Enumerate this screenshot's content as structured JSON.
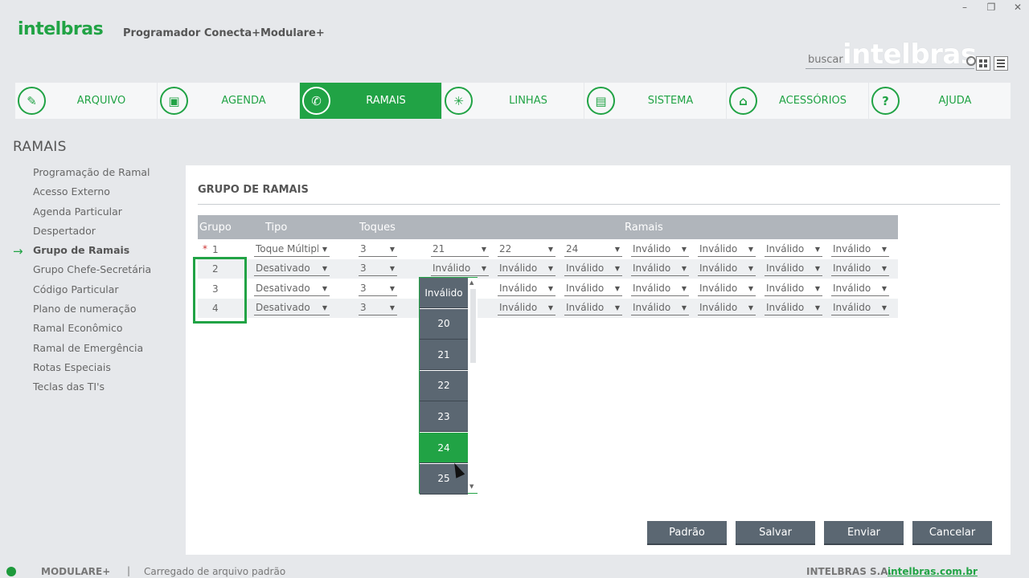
{
  "app": {
    "brand": "intelbras",
    "title": "Programador Conecta+Modulare+",
    "window_controls": [
      "–",
      "❐",
      "✕"
    ]
  },
  "search": {
    "label": "buscar",
    "brand": "intelbras"
  },
  "nav": {
    "tabs": [
      {
        "label": "ARQUIVO",
        "icon": "paperclip-icon",
        "glyph": "✎",
        "active": false
      },
      {
        "label": "AGENDA",
        "icon": "contacts-icon",
        "glyph": "▣",
        "active": false
      },
      {
        "label": "RAMAIS",
        "icon": "phone-icon",
        "glyph": "✆",
        "active": true
      },
      {
        "label": "LINHAS",
        "icon": "network-icon",
        "glyph": "✳",
        "active": false
      },
      {
        "label": "SISTEMA",
        "icon": "system-folder-icon",
        "glyph": "▤",
        "active": false
      },
      {
        "label": "ACESSÓRIOS",
        "icon": "accessories-icon",
        "glyph": "⌂",
        "active": false
      },
      {
        "label": "AJUDA",
        "icon": "help-icon",
        "glyph": "?",
        "active": false
      }
    ]
  },
  "sidebar": {
    "title": "RAMAIS",
    "items": [
      "Programação de Ramal",
      "Acesso Externo",
      "Agenda Particular",
      "Despertador",
      "Grupo de Ramais",
      "Grupo Chefe-Secretária",
      "Código Particular",
      "Plano de numeração",
      "Ramal Econômico",
      "Ramal de Emergência",
      "Rotas Especiais",
      "Teclas das TI's"
    ],
    "active_index": 4,
    "arrow": "→"
  },
  "panel": {
    "title": "GRUPO DE RAMAIS",
    "headers": {
      "grupo": "Grupo",
      "tipo": "Tipo",
      "toques": "Toques",
      "ramais": "Ramais"
    },
    "rows": [
      {
        "grupo": "1",
        "required": "*",
        "tipo": "Toque Múltiplo",
        "toques": "3",
        "ramais": [
          "21",
          "22",
          "24",
          "Inválido",
          "Inválido",
          "Inválido",
          "Inválido"
        ]
      },
      {
        "grupo": "2",
        "required": "",
        "tipo": "Desativado",
        "toques": "3",
        "ramais": [
          "Inválido",
          "Inválido",
          "Inválido",
          "Inválido",
          "Inválido",
          "Inválido",
          "Inválido"
        ]
      },
      {
        "grupo": "3",
        "required": "",
        "tipo": "Desativado",
        "toques": "3",
        "ramais": [
          "",
          "Inválido",
          "Inválido",
          "Inválido",
          "Inválido",
          "Inválido",
          "Inválido"
        ]
      },
      {
        "grupo": "4",
        "required": "",
        "tipo": "Desativado",
        "toques": "3",
        "ramais": [
          "",
          "Inválido",
          "Inválido",
          "Inválido",
          "Inválido",
          "Inválido",
          "Inválido"
        ]
      }
    ]
  },
  "dropdown": {
    "options": [
      "Inválido",
      "20",
      "21",
      "22",
      "23",
      "24",
      "25"
    ],
    "selected": "24"
  },
  "buttons": {
    "padrao": "Padrão",
    "salvar": "Salvar",
    "enviar": "Enviar",
    "cancelar": "Cancelar"
  },
  "status": {
    "product": "MODULARE+",
    "separator": "|",
    "message": "Carregado de arquivo padrão",
    "company": "INTELBRAS S.A.",
    "link": "intelbras.com.br"
  },
  "colors": {
    "accent": "#21a345",
    "button_bg": "#5b6772",
    "table_header": "#b0b5bb"
  }
}
